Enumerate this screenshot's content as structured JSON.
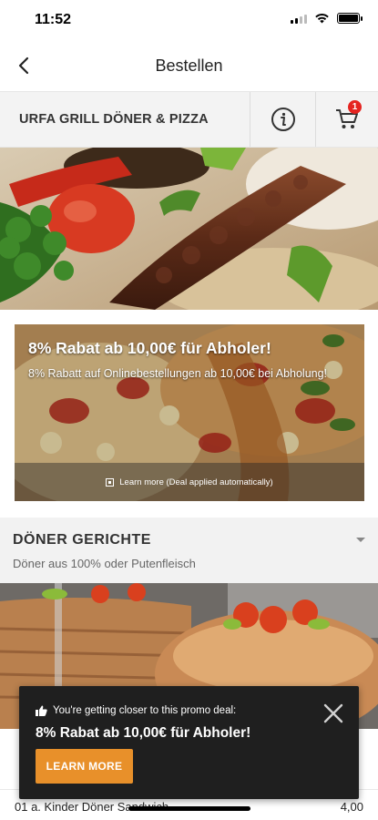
{
  "status_bar": {
    "time": "11:52"
  },
  "nav": {
    "title": "Bestellen",
    "back_icon": "chevron-left-icon"
  },
  "restaurant": {
    "name": "URFA GRILL DÖNER & PIZZA",
    "info_icon": "info-icon",
    "cart_icon": "cart-icon",
    "cart_count": "1"
  },
  "deal": {
    "title": "8% Rabat ab 10,00€ für Abholer!",
    "description": "8% Rabatt auf Onlinebestellungen ab 10,00€ bei Abholung!",
    "learn_more": "Learn more (Deal applied automatically)"
  },
  "category": {
    "title": "DÖNER GERICHTE",
    "subtitle": "Döner aus 100% oder Putenfleisch"
  },
  "menu_items": [
    {
      "name": "01 a. Kinder Döner Sandwich",
      "price": "4,00"
    }
  ],
  "toast": {
    "hint": "You're getting closer to this promo deal:",
    "title": "8% Rabat ab 10,00€ für Abholer!",
    "button": "LEARN MORE",
    "hint_icon": "thumbs-up-icon",
    "close_icon": "close-icon"
  },
  "colors": {
    "accent": "#e8902a",
    "badge": "#e52420",
    "toast_bg": "#1f1f1f"
  }
}
